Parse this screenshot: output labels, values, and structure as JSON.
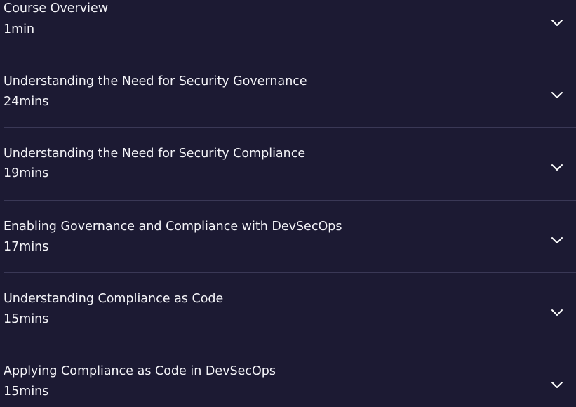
{
  "modules": [
    {
      "title": "Course Overview",
      "duration": "1min"
    },
    {
      "title": "Understanding the Need for Security Governance",
      "duration": "24mins"
    },
    {
      "title": "Understanding the Need for Security Compliance",
      "duration": "19mins"
    },
    {
      "title": "Enabling Governance and Compliance with DevSecOps",
      "duration": "17mins"
    },
    {
      "title": "Understanding Compliance as Code",
      "duration": "15mins"
    },
    {
      "title": "Applying Compliance as Code in DevSecOps",
      "duration": "15mins"
    }
  ],
  "icons": {
    "expand": "chevron-down-icon"
  },
  "colors": {
    "background": "#1c1a33",
    "divider": "#3a3856",
    "text": "#f4f4f8"
  }
}
